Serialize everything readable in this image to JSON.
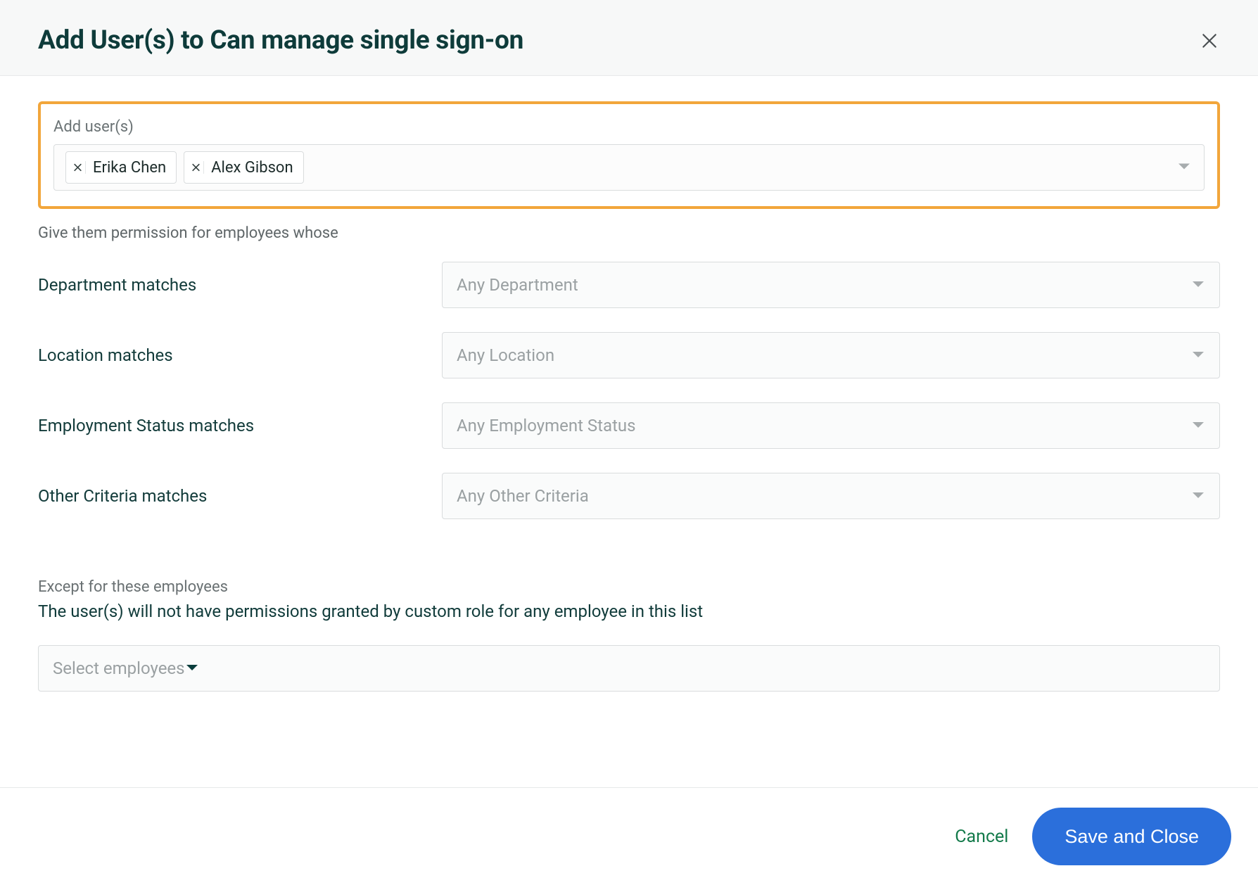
{
  "header": {
    "title": "Add User(s) to Can manage single sign-on"
  },
  "add_users": {
    "label": "Add user(s)",
    "chips": [
      "Erika Chen",
      "Alex Gibson"
    ]
  },
  "permission_intro": "Give them permission for employees whose",
  "criteria": [
    {
      "label": "Department matches",
      "placeholder": "Any Department"
    },
    {
      "label": "Location matches",
      "placeholder": "Any Location"
    },
    {
      "label": "Employment Status matches",
      "placeholder": "Any Employment Status"
    },
    {
      "label": "Other Criteria matches",
      "placeholder": "Any Other Criteria"
    }
  ],
  "except": {
    "label": "Except for these employees",
    "description": "The user(s) will not have permissions granted by custom role for any employee in this list",
    "placeholder": "Select employees"
  },
  "footer": {
    "cancel": "Cancel",
    "save": "Save and Close"
  }
}
